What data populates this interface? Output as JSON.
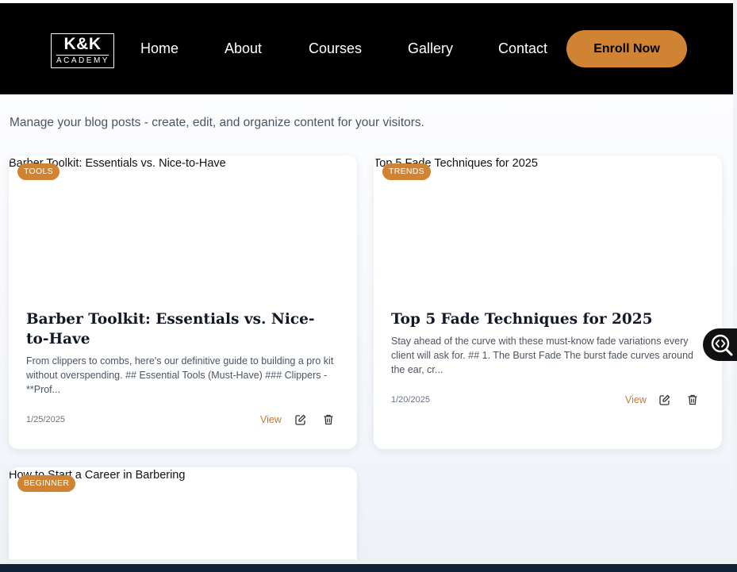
{
  "nav": {
    "logo_main": "K&K",
    "logo_sub": "ACADEMY",
    "links": [
      {
        "label": "Home"
      },
      {
        "label": "About"
      },
      {
        "label": "Courses"
      },
      {
        "label": "Gallery"
      },
      {
        "label": "Contact"
      }
    ],
    "enroll_label": "Enroll Now"
  },
  "page": {
    "subtitle": "Manage your blog posts - create, edit, and organize content for your visitors."
  },
  "posts": [
    {
      "image_alt": "Barber Toolkit: Essentials vs. Nice-to-Have",
      "badge": "TOOLS",
      "title": "Barber Toolkit: Essentials vs. Nice-to-Have",
      "excerpt": "From clippers to combs, here's our definitive guide to building a pro kit without overspending. ## Essential Tools (Must-Have) ### Clippers - **Prof...",
      "date": "1/25/2025",
      "view_label": "View"
    },
    {
      "image_alt": "Top 5 Fade Techniques for 2025",
      "badge": "TRENDS",
      "title": "Top 5 Fade Techniques for 2025",
      "excerpt": "Stay ahead of the curve with these must-know fade variations every client will ask for. ## 1. The Burst Fade The burst fade curves around the ear, cr...",
      "date": "1/20/2025",
      "view_label": "View"
    },
    {
      "image_alt": "How to Start a Career in Barbering",
      "badge": "BEGINNER"
    }
  ],
  "colors": {
    "accent": "#d08433",
    "navbar": "#000000",
    "link": "#c27a2c"
  },
  "icons": {
    "edit": "edit-icon",
    "delete": "trash-icon",
    "floating": "code-search-icon"
  }
}
